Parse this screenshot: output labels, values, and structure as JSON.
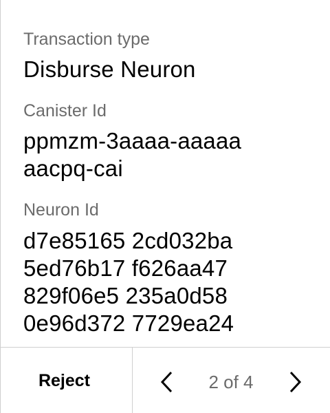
{
  "fields": [
    {
      "label": "Transaction type",
      "value_lines": [
        "Disburse Neuron"
      ]
    },
    {
      "label": "Canister Id",
      "value_lines": [
        "ppmzm-3aaaa-aaaaa",
        "aacpq-cai"
      ]
    },
    {
      "label": "Neuron Id",
      "value_lines": [
        "d7e85165 2cd032ba",
        "5ed76b17 f626aa47",
        "829f06e5 235a0d58",
        "0e96d372 7729ea24"
      ]
    }
  ],
  "footer": {
    "reject_label": "Reject",
    "page_indicator": "2 of 4",
    "prev_icon": "chevron-left-icon",
    "next_icon": "chevron-right-icon"
  },
  "colors": {
    "label": "#6b6b6b",
    "value": "#000000",
    "divider": "#cfcfcf"
  }
}
